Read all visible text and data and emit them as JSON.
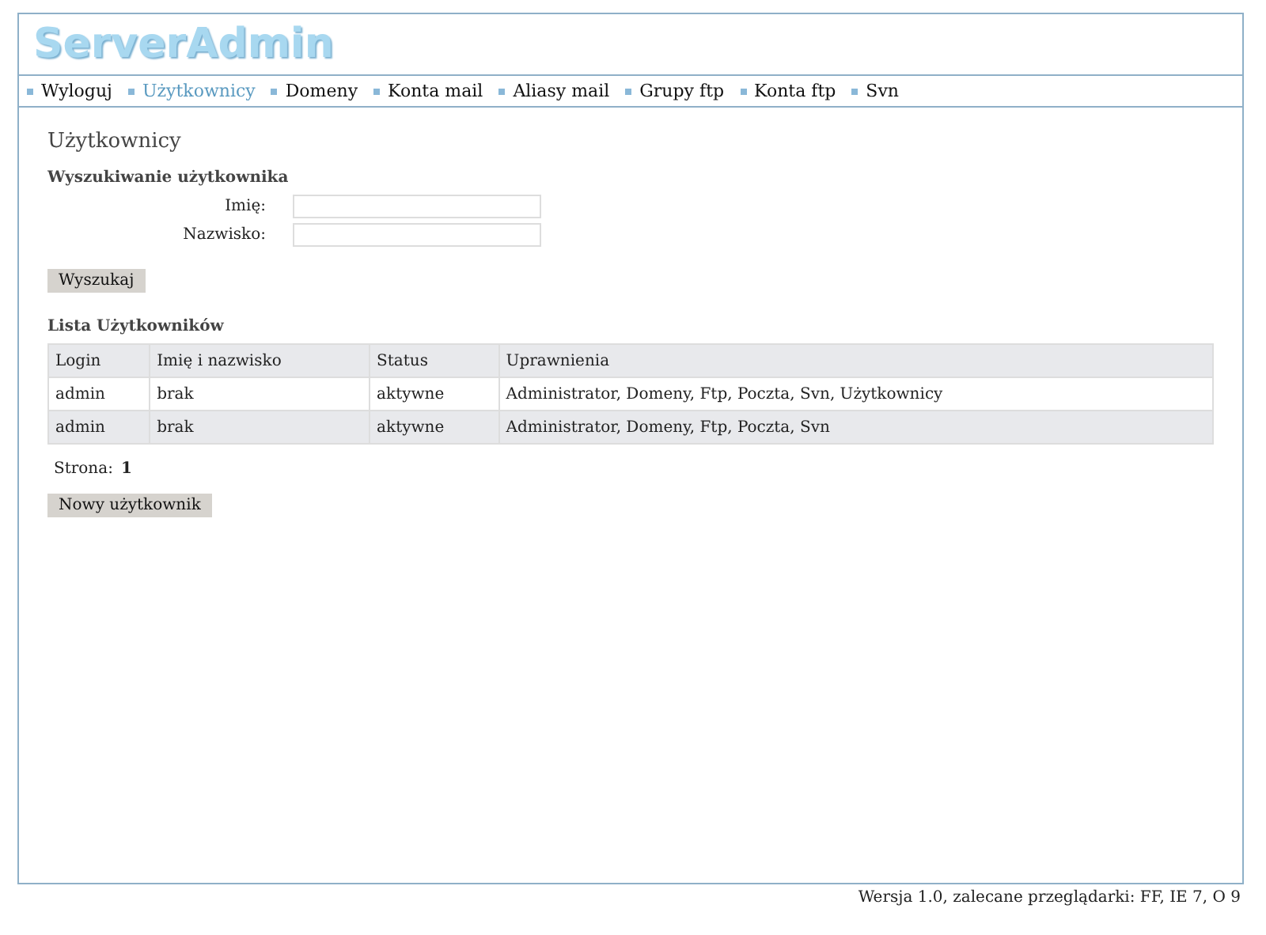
{
  "logo": "ServerAdmin",
  "nav": [
    {
      "label": "Wyloguj",
      "selected": false
    },
    {
      "label": "Użytkownicy",
      "selected": true
    },
    {
      "label": "Domeny",
      "selected": false
    },
    {
      "label": "Konta mail",
      "selected": false
    },
    {
      "label": "Aliasy mail",
      "selected": false
    },
    {
      "label": "Grupy ftp",
      "selected": false
    },
    {
      "label": "Konta ftp",
      "selected": false
    },
    {
      "label": "Svn",
      "selected": false
    }
  ],
  "page_title": "Użytkownicy",
  "search": {
    "heading": "Wyszukiwanie użytkownika",
    "fields": [
      {
        "label": "Imię:"
      },
      {
        "label": "Nazwisko:"
      }
    ],
    "button": "Wyszukaj"
  },
  "table": {
    "heading": "Lista Użytkowników",
    "columns": [
      "Login",
      "Imię i nazwisko",
      "Status",
      "Uprawnienia"
    ],
    "rows": [
      [
        "admin",
        "brak",
        "aktywne",
        "Administrator, Domeny, Ftp, Poczta, Svn, Użytkownicy"
      ],
      [
        "admin",
        "brak",
        "aktywne",
        "Administrator, Domeny, Ftp, Poczta, Svn"
      ]
    ]
  },
  "pagination": {
    "label": "Strona:",
    "page": "1"
  },
  "new_button": "Nowy użytkownik",
  "footer": "Wersja 1.0, zalecane przeglądarki: FF, IE 7, O 9"
}
